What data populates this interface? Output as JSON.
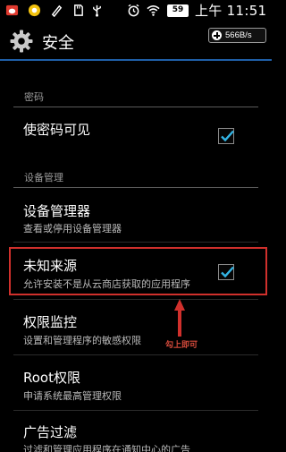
{
  "status_bar": {
    "battery": "59",
    "time": "上午 11:51",
    "icons": [
      "weibo-icon",
      "qq-icon",
      "edit-icon",
      "sd-card-icon",
      "usb-icon",
      "alarm-icon",
      "wifi-icon",
      "battery-icon"
    ]
  },
  "action_bar": {
    "title": "安全",
    "icon": "gear-icon",
    "speed": "566B/s"
  },
  "sections": {
    "password": "密码",
    "device_admin": "设备管理"
  },
  "rows": {
    "show_password": {
      "title": "使密码可见",
      "checked": true
    },
    "device_managers": {
      "title": "设备管理器",
      "summary": "查看或停用设备管理器"
    },
    "unknown_sources": {
      "title": "未知来源",
      "summary": "允许安装不是从云商店获取的应用程序",
      "checked": true
    },
    "permission_monitor": {
      "title": "权限监控",
      "summary": "设置和管理程序的敏感权限"
    },
    "root": {
      "title": "Root权限",
      "summary": "申请系统最高管理权限"
    },
    "ad_filter": {
      "title": "广告过滤",
      "summary": "过滤和管理应用程序在通知中心的广告"
    }
  },
  "annotation": {
    "note": "勾上即可",
    "color": "#d0302c"
  },
  "colors": {
    "accent": "#1f5fa8",
    "check": "#33b5e5"
  }
}
